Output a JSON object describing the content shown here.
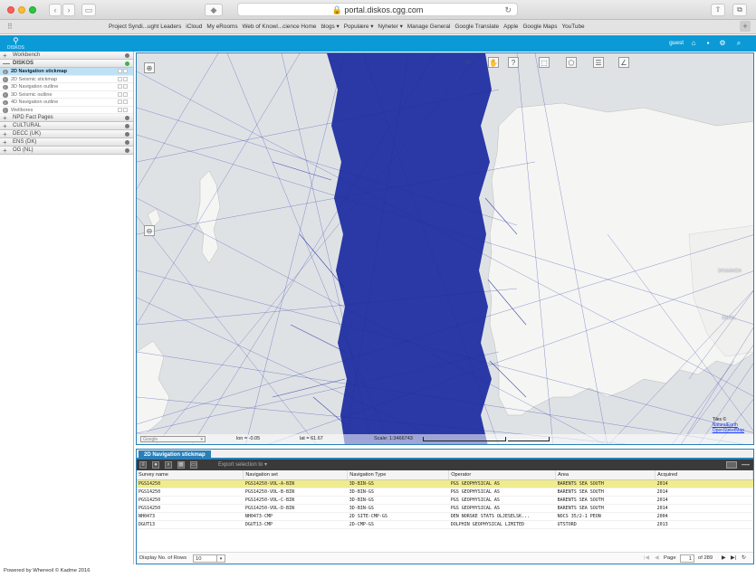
{
  "browser": {
    "url": "portal.diskos.cgg.com",
    "bookmarks": [
      "Project Syndi...ught Leaders",
      "iCloud",
      "My eRooms",
      "Web of Knowl...cience Home",
      "blogs ▾",
      "Populære ▾",
      "Nyheter ▾",
      "Manage General",
      "Google Translate",
      "Apple",
      "Google Maps",
      "YouTube"
    ]
  },
  "header": {
    "logo": "DISKOS",
    "user": "guest"
  },
  "layer_tree": {
    "groups_top": [
      {
        "label": "Workbench",
        "sign": "+"
      }
    ],
    "open_group": {
      "label": "DISKOS",
      "sign": "—"
    },
    "items": [
      {
        "label": "2D Navigation stickmap",
        "selected": true
      },
      {
        "label": "2D Seismic stickmap",
        "selected": false
      },
      {
        "label": "3D Navigation outline",
        "selected": false
      },
      {
        "label": "3D Seismic outline",
        "selected": false
      },
      {
        "label": "4D Navigation outline",
        "selected": false
      },
      {
        "label": "Wellbores",
        "selected": false
      }
    ],
    "groups_bottom": [
      {
        "label": "NPD Fact Pages",
        "sign": "+"
      },
      {
        "label": "CULTURAL",
        "sign": "+"
      },
      {
        "label": "DECC (UK)",
        "sign": "+"
      },
      {
        "label": "ENS (DK)",
        "sign": "+"
      },
      {
        "label": "OG (NL)",
        "sign": "+"
      }
    ]
  },
  "map": {
    "basemap": "Google",
    "lon": "lon = -0.05",
    "lat": "lat = 61.67",
    "scale": "Scale: 1:3466743",
    "places": [
      "DRAMMEN",
      "SKIEN"
    ],
    "attribution": [
      "Tiles ©",
      "NaturalEarth",
      "OpenStreetMap"
    ]
  },
  "panel": {
    "tab": "2D Navigation stickmap",
    "export_label": "Export selection to ▾",
    "columns": [
      "Survey name",
      "Navigation set",
      "Navigation Type",
      "Operator",
      "Area",
      "Acquired"
    ],
    "rows": [
      [
        "PGS14250",
        "PGS14250-VOL-A-BIN",
        "3D-BIN-GS",
        "PGS GEOPHYSICAL AS",
        "BARENTS SEA SOUTH",
        "2014"
      ],
      [
        "PGS14250",
        "PGS14250-VOL-B-BIN",
        "3D-BIN-GS",
        "PGS GEOPHYSICAL AS",
        "BARENTS SEA SOUTH",
        "2014"
      ],
      [
        "PGS14250",
        "PGS14250-VOL-C-BIN",
        "3D-BIN-GS",
        "PGS GEOPHYSICAL AS",
        "BARENTS SEA SOUTH",
        "2014"
      ],
      [
        "PGS14250",
        "PGS14250-VOL-D-BIN",
        "3D-BIN-GS",
        "PGS GEOPHYSICAL AS",
        "BARENTS SEA SOUTH",
        "2014"
      ],
      [
        "NH0473",
        "NH0473-CMP",
        "2D SITE-CMP-GS",
        "DEN NORSKE STATS OLJESELSK...",
        "NOCS 35/2-1 PEON",
        "2004"
      ],
      [
        "DGUT13",
        "DGUT13-CMP",
        "2D-CMP-GS",
        "DOLPHIN GEOPHYSICAL LIMITED",
        "UTSTORD",
        "2013"
      ]
    ],
    "pager": {
      "rows_label": "Display No. of Rows",
      "rows_value": "10",
      "page_label": "Page",
      "page_value": "1",
      "page_total": "of 289"
    }
  },
  "footer": "Powered by Whereoil © Kadme 2016"
}
